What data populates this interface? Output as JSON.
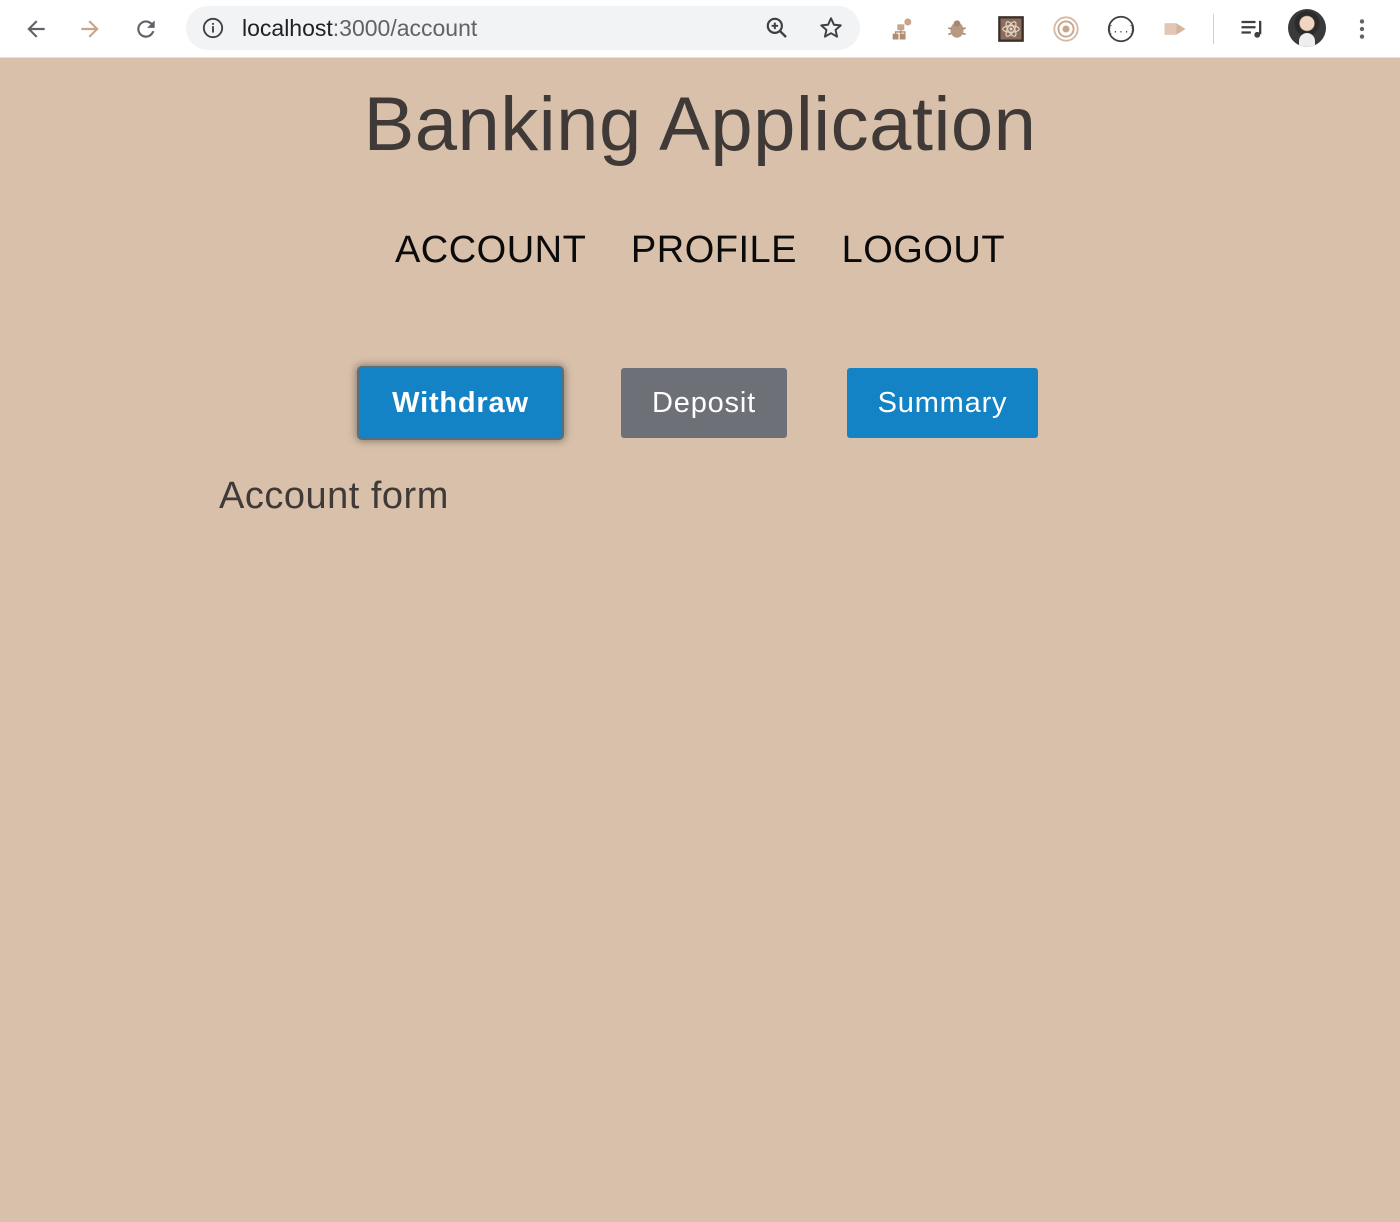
{
  "browser": {
    "url_host": "localhost",
    "url_path": ":3000/account",
    "icons": {
      "back": "back-arrow-icon",
      "forward": "forward-arrow-icon",
      "reload": "reload-icon",
      "info": "info-icon",
      "zoom": "zoom-in-icon",
      "bookmark": "star-icon",
      "menu": "more-vert-icon"
    },
    "extensions": [
      "extension-org-icon",
      "extension-bug-icon",
      "extension-react-icon",
      "extension-target-icon",
      "extension-json-icon",
      "extension-media-icon",
      "playlist-icon"
    ]
  },
  "app": {
    "title": "Banking Application"
  },
  "nav": {
    "account": "ACCOUNT",
    "profile": "PROFILE",
    "logout": "LOGOUT"
  },
  "actions": {
    "withdraw": "Withdraw",
    "deposit": "Deposit",
    "summary": "Summary"
  },
  "main": {
    "form_heading": "Account form"
  },
  "colors": {
    "page_background": "#d9c0aa",
    "primary_button": "#1383c6",
    "secondary_button": "#6d7177",
    "title_text": "#3f3a38"
  }
}
